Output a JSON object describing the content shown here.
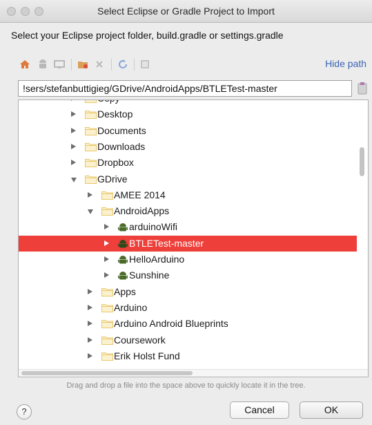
{
  "window": {
    "title": "Select Eclipse or Gradle Project to Import",
    "subtitle": "Select your Eclipse project folder, build.gradle or settings.gradle"
  },
  "toolbar": {
    "icons": [
      "home-icon",
      "android-icon",
      "desktop-icon",
      "new-folder-icon",
      "delete-icon",
      "refresh-icon",
      "show-hidden-icon"
    ],
    "hide_path_label": "Hide path"
  },
  "path": {
    "value": "!sers/stefanbuttigieg/GDrive/AndroidApps/BTLETest-master"
  },
  "tree": {
    "items": [
      {
        "label": "Copy",
        "icon": "folder-icon",
        "expanded": false
      },
      {
        "label": "Desktop",
        "icon": "folder-icon",
        "expanded": false
      },
      {
        "label": "Documents",
        "icon": "folder-icon",
        "expanded": false
      },
      {
        "label": "Downloads",
        "icon": "folder-icon",
        "expanded": false
      },
      {
        "label": "Dropbox",
        "icon": "folder-icon",
        "expanded": false
      },
      {
        "label": "GDrive",
        "icon": "folder-icon",
        "expanded": true
      },
      {
        "label": "AMEE 2014",
        "icon": "folder-icon",
        "expanded": false
      },
      {
        "label": "AndroidApps",
        "icon": "folder-icon",
        "expanded": true
      },
      {
        "label": "arduinoWifi",
        "icon": "android-project-icon",
        "expanded": false
      },
      {
        "label": "BTLETest-master",
        "icon": "android-project-icon",
        "expanded": false,
        "selected": true
      },
      {
        "label": "HelloArduino",
        "icon": "android-project-icon",
        "expanded": false
      },
      {
        "label": "Sunshine",
        "icon": "android-project-icon",
        "expanded": false
      },
      {
        "label": "Apps",
        "icon": "folder-icon",
        "expanded": false
      },
      {
        "label": "Arduino",
        "icon": "folder-icon",
        "expanded": false
      },
      {
        "label": "Arduino Android Blueprints",
        "icon": "folder-icon",
        "expanded": false
      },
      {
        "label": "Coursework",
        "icon": "folder-icon",
        "expanded": false
      },
      {
        "label": "Erik Holst Fund",
        "icon": "folder-icon",
        "expanded": false
      }
    ]
  },
  "hint": "Drag and drop a file into the space above to quickly locate it in the tree.",
  "buttons": {
    "help_label": "?",
    "cancel_label": "Cancel",
    "ok_label": "OK"
  },
  "colors": {
    "selection": "#ee3f3a",
    "link": "#3a63b5",
    "folder": "#e8c86b",
    "android": "#4b6b2a"
  }
}
